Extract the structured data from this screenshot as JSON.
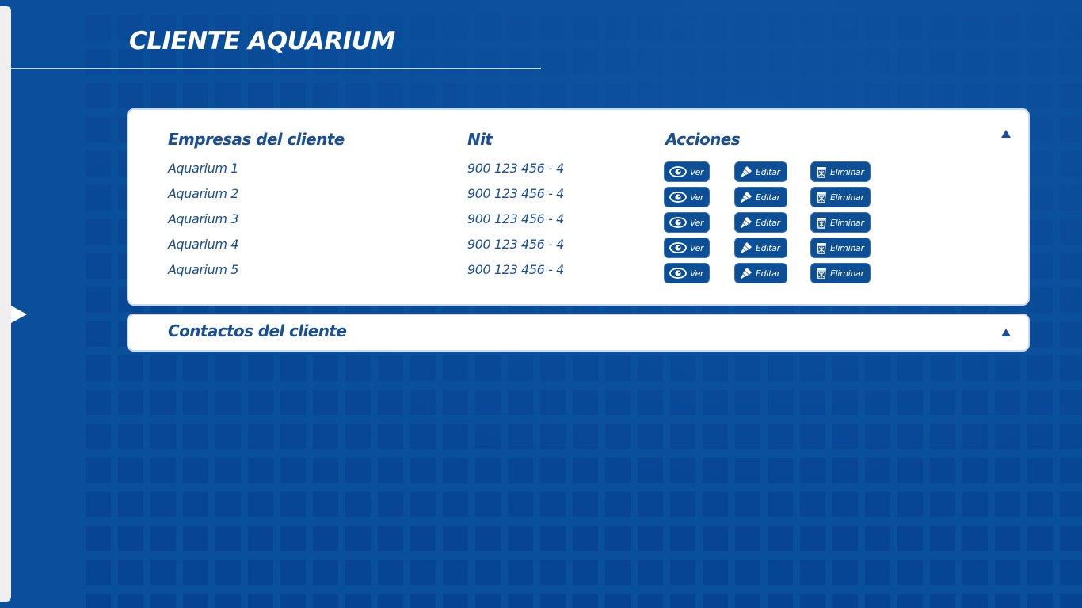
{
  "page": {
    "title": "CLIENTE AQUARIUM"
  },
  "companies_section": {
    "headers": {
      "company": "Empresas del cliente",
      "nit": "Nit",
      "actions": "Acciones"
    },
    "rows": [
      {
        "name": "Aquarium 1",
        "nit": "900 123 456 - 4"
      },
      {
        "name": "Aquarium 2",
        "nit": "900 123 456 - 4"
      },
      {
        "name": "Aquarium 3",
        "nit": "900 123 456 - 4"
      },
      {
        "name": "Aquarium 4",
        "nit": "900 123 456 - 4"
      },
      {
        "name": "Aquarium 5",
        "nit": "900 123 456 - 4"
      }
    ],
    "actions": {
      "view_label": "Ver",
      "edit_label": "Editar",
      "delete_label": "Eliminar"
    },
    "collapse_icon": "triangle-up-icon"
  },
  "contacts_section": {
    "title": "Contactos del cliente",
    "collapse_icon": "triangle-up-icon"
  },
  "colors": {
    "background": "#0a4f9a",
    "accent_text": "#1a4f93",
    "button_bg": "#0d4f96",
    "card_bg": "#ffffff"
  }
}
